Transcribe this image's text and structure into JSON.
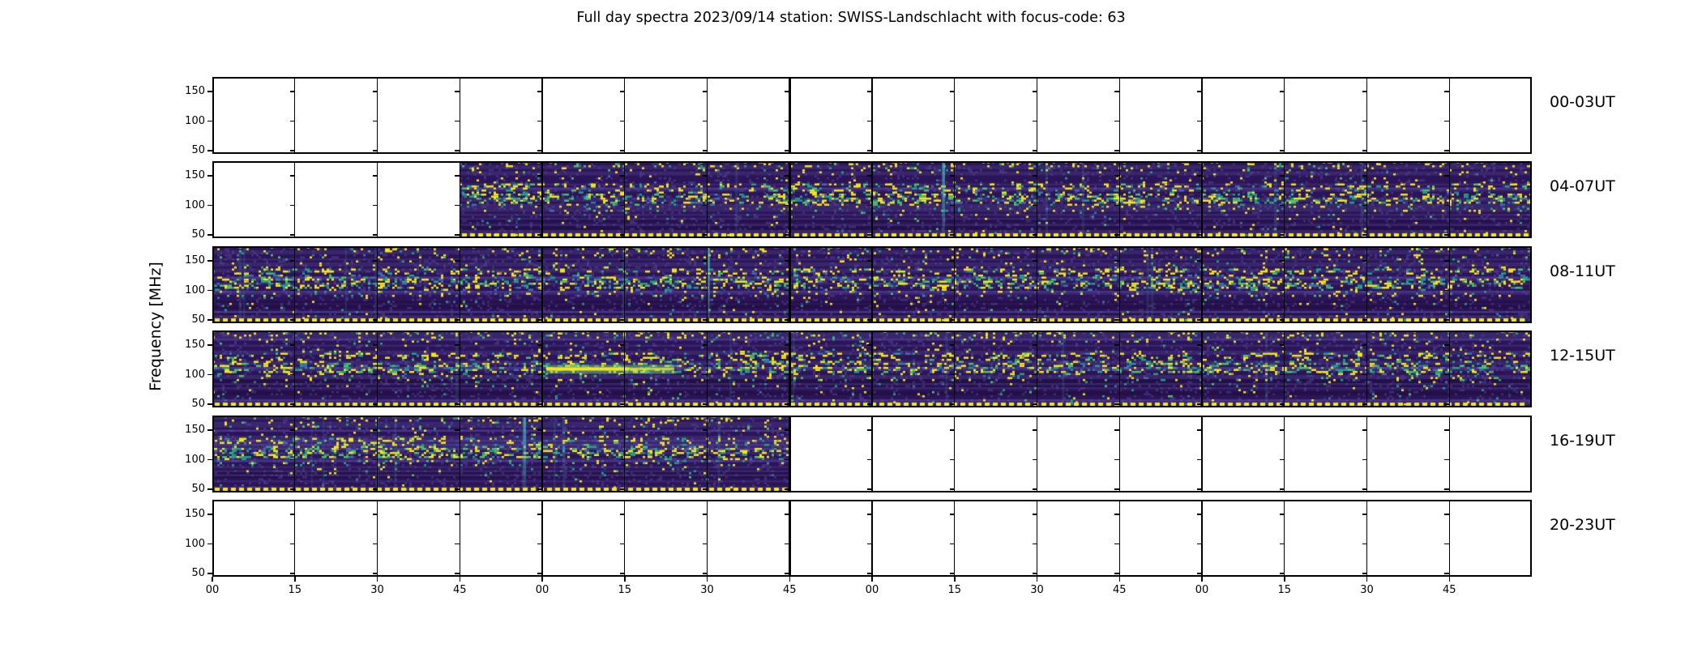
{
  "figure": {
    "title": "Full day spectra 2023/09/14 station: SWISS-Landschlacht with focus-code: 63"
  },
  "chart_data": {
    "type": "heatmap",
    "subtype": "solar-radio-spectrogram-overview",
    "title": "Full day spectra 2023/09/14 station: SWISS-Landschlacht with focus-code: 63",
    "date": "2023/09/14",
    "station": "SWISS-Landschlacht",
    "focus_code": "63",
    "ylabel": "Frequency [MHz]",
    "y_ticks": [
      "150",
      "100",
      "50"
    ],
    "y_range_mhz": [
      45,
      175
    ],
    "x_tick_labels": [
      "00",
      "15",
      "30",
      "45",
      "00",
      "15",
      "30",
      "45",
      "00",
      "15",
      "30",
      "45",
      "00",
      "15",
      "30",
      "45"
    ],
    "x_tick_interval_minutes": 15,
    "hours_per_row": 4,
    "segments_per_row": 16,
    "thick_boundary_segment": 7,
    "colormap": "viridis",
    "grid": "off",
    "legend": "none",
    "active_bands_mhz": [
      [
        160,
        172
      ],
      [
        133,
        143
      ],
      [
        100,
        127
      ]
    ],
    "rows": [
      {
        "label": "00-03UT",
        "coverage": [],
        "note": "no data (empty white panels)"
      },
      {
        "label": "04-07UT",
        "coverage": [
          [
            3,
            16
          ]
        ],
        "data_start_ut": "04:45",
        "streak_segments": [
          8.85
        ]
      },
      {
        "label": "08-11UT",
        "coverage": [
          [
            0,
            16
          ]
        ],
        "streak_segments": [
          6.0
        ]
      },
      {
        "label": "12-15UT",
        "coverage": [
          [
            0,
            16
          ]
        ],
        "event": {
          "start_seg": 4.05,
          "end_seg": 5.6,
          "y_frac": 0.5,
          "description": "bright narrowband emission near 110 MHz around 13:00-13:25 UT"
        }
      },
      {
        "label": "16-19UT",
        "coverage": [
          [
            0,
            7
          ]
        ],
        "data_end_ut": "17:45",
        "streak_segments": [
          3.77
        ]
      },
      {
        "label": "20-23UT",
        "coverage": [],
        "note": "no data (empty white panels)"
      }
    ]
  },
  "palette": {
    "background": "#ffffff",
    "axis": "#000000",
    "bg_dark": "#2c1458",
    "bg_mid": "#39266b",
    "bg_light": "#473489",
    "bg_deep": "#241047",
    "speckle_yellow": "#f4e41c",
    "speckle_green": "#4ac16d",
    "speckle_teal": "#1fa187",
    "speckle_blue": "#3e6fb0",
    "streak_teal": "#4cc3c9",
    "dotted_line": "#f4e41c"
  }
}
